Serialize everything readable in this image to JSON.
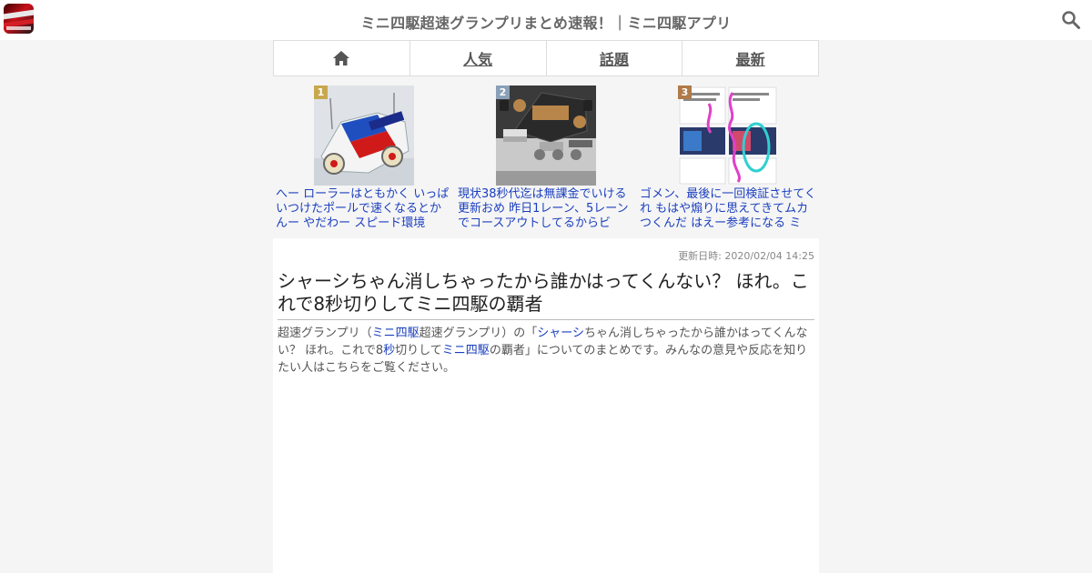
{
  "header": {
    "title": "ミニ四駆超速グランプリまとめ速報！｜ミニ四駆アプリ",
    "logo_icon": "app-logo",
    "search_icon": "search-icon"
  },
  "nav": {
    "home_icon": "home-icon",
    "tabs": [
      {
        "label": "人気"
      },
      {
        "label": "話題"
      },
      {
        "label": "最新"
      }
    ]
  },
  "ranking": [
    {
      "rank": "1",
      "text": "へー ローラーはともかく いっぱいつけたポールで速くなるとかんー やだわー スピード環境",
      "badge_color": "#c8a84e"
    },
    {
      "rank": "2",
      "text": "現状38秒代迄は無課金でいける 更新おめ 昨日1レーン、5レーンでコースアウトしてるからビ",
      "badge_color": "#8aa0b8"
    },
    {
      "rank": "3",
      "text": "ゴメン、最後に一回検証させてくれ もはや煽りに思えてきてムカつくんだ はえー参考になる ミ",
      "badge_color": "#b07a4a"
    }
  ],
  "article": {
    "updated": "更新日時: 2020/02/04 14:25",
    "title": "シャーシちゃん消しちゃったから誰かはってくんない？ ほれ。これで8秒切りしてミニ四駆の覇者",
    "summary": {
      "p1": "超速グランプリ（",
      "k1": "ミニ四駆",
      "p2": "超速グランプリ）の「",
      "k2": "シャーシ",
      "p3": "ちゃん消しちゃったから誰かはってくんない？ ほれ。これで8",
      "k3": "秒",
      "p4": "切りして",
      "k4": "ミニ四駆",
      "p5": "の覇者」についてのまとめです。みんなの意見や反応を知りたい人はこちらをご覧ください。"
    }
  }
}
